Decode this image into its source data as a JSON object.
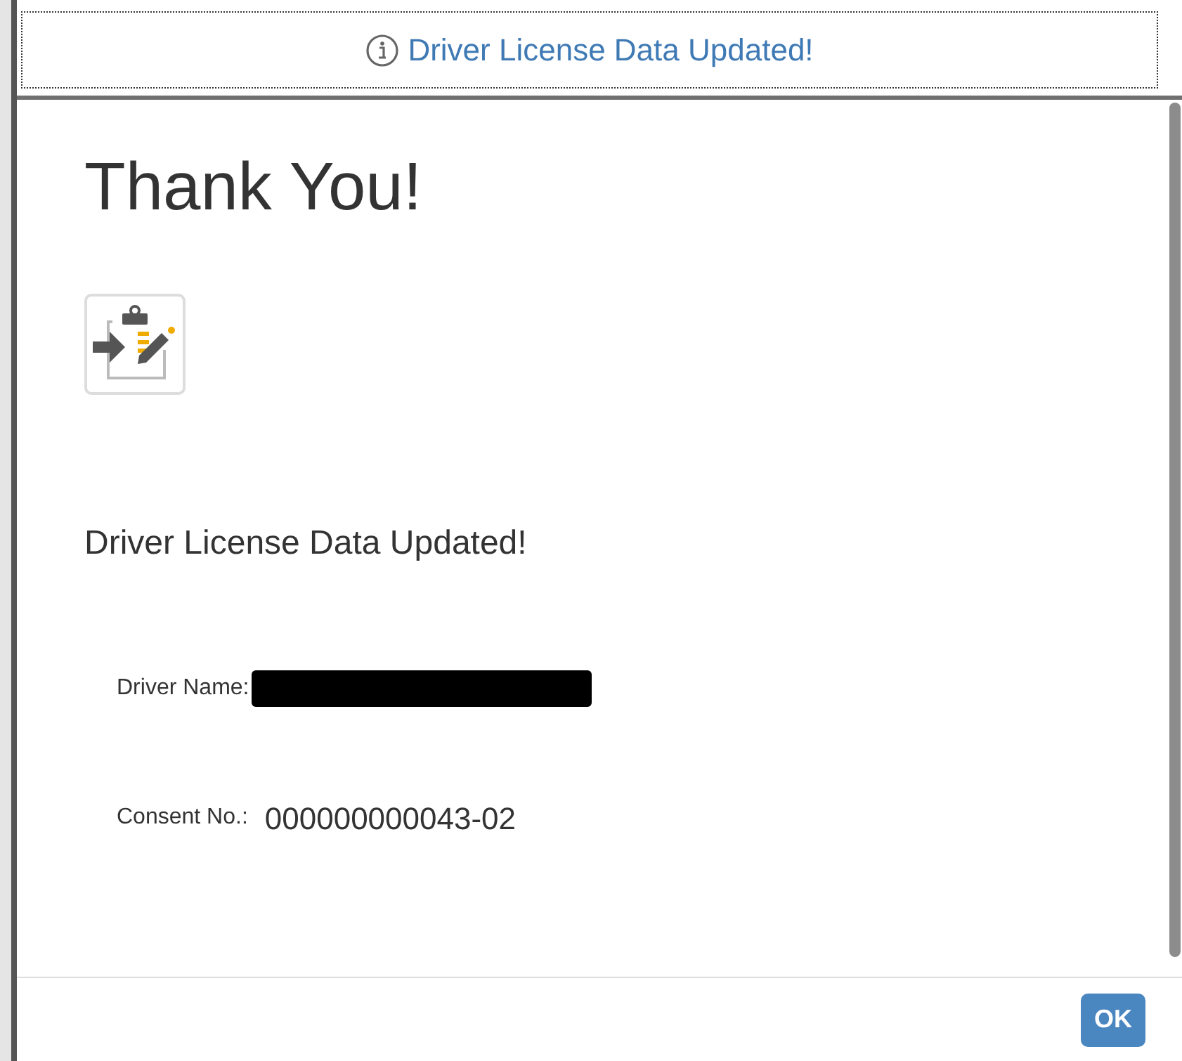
{
  "notification": {
    "message": "Driver License Data Updated!"
  },
  "dialog": {
    "title": "Thank You!",
    "heading": "Driver License Data Updated!",
    "fields": [
      {
        "label": "Driver Name:",
        "redacted": true
      },
      {
        "label": "Consent No.:",
        "value": "000000000043-02",
        "redacted": false
      }
    ],
    "buttons": [
      "OK"
    ]
  }
}
